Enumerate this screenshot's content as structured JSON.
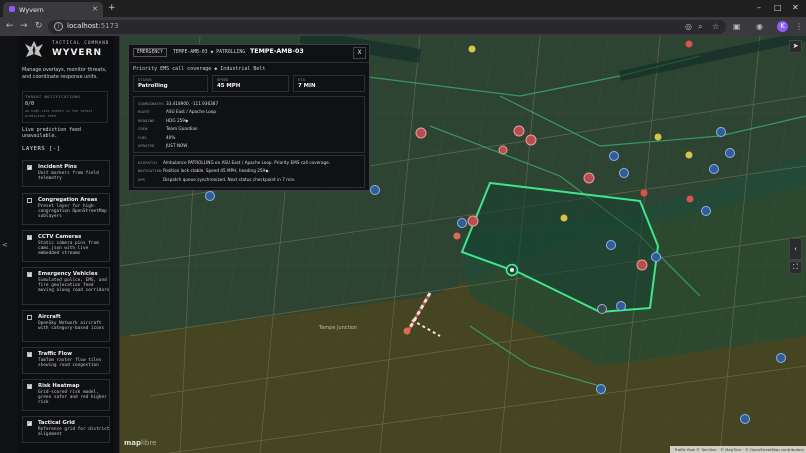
{
  "browser": {
    "tab_title": "Wyvern",
    "url_host": "localhost",
    "url_port": ":5173",
    "avatar_letter": "K"
  },
  "sidebar": {
    "brand_sub": "TACTICAL COMMAND",
    "brand_name": "WYVERN",
    "description": "Manage overlays, monitor threats, and coordinate response units.",
    "threat": {
      "title": "THREAT NOTIFICATIONS",
      "count": "0/0",
      "note": "no high-risk events in the latest prediction feed."
    },
    "feed_status": "Live prediction feed unavailable.",
    "layers_heading": "LAYERS [-]",
    "layers": [
      {
        "name": "Incident Pins",
        "desc": "Unit markers from field telemetry",
        "checked": true
      },
      {
        "name": "Congregation Areas",
        "desc": "Preset layer for high-congregation OpenStreetMap sublayers",
        "checked": false
      },
      {
        "name": "CCTV Cameras",
        "desc": "Static camera pins from cams.json with live embedded streams",
        "checked": true
      },
      {
        "name": "Emergency Vehicles",
        "desc": "Simulated police, EMS, and fire geolocation feed moving along road corridors",
        "checked": true
      },
      {
        "name": "Aircraft",
        "desc": "OpenSky Network aircraft with category-based icons",
        "checked": false
      },
      {
        "name": "Traffic Flow",
        "desc": "TomTom raster flow tiles showing road congestion",
        "checked": true
      },
      {
        "name": "Risk Heatmap",
        "desc": "Grid-scored risk model, green safer and red higher risk",
        "checked": true
      },
      {
        "name": "Tactical Grid",
        "desc": "Reference grid for district alignment",
        "checked": true
      }
    ]
  },
  "popup": {
    "tag": "EMERGENCY",
    "callsign_small": "TEMPE-AMB-03",
    "state_small": "PATROLLING",
    "callsign": "TEMPE-AMB-03",
    "close_label": "X",
    "subline": "Priority EMS call coverage ◆ Industrial Belt",
    "stats": [
      {
        "label": "STATUS",
        "value": "Patrolling"
      },
      {
        "label": "SPEED",
        "value": "45 MPH"
      },
      {
        "label": "ETA",
        "value": "7 MIN"
      }
    ],
    "details": [
      {
        "label": "COORDINATES",
        "value": "33.418900, -111.936387"
      },
      {
        "label": "ROUTE",
        "value": "ASU East / Apache Loop"
      },
      {
        "label": "HEADING",
        "value": "HDG 259◆"
      },
      {
        "label": "CREW",
        "value": "Team Guardian"
      },
      {
        "label": "FUEL",
        "value": "40%"
      },
      {
        "label": "UPDATED",
        "value": "JUST NOW"
      }
    ],
    "logs": [
      {
        "label": "DISPATCH",
        "value": "Ambulance PATROLLING on ASU East / Apache Loop. Priority EMS call coverage."
      },
      {
        "label": "NAVIGATION",
        "value": "Position lock stable. Speed 45 MPH, heading 259◆."
      },
      {
        "label": "OPS",
        "value": "Dispatch queue synchronized. Next status checkpoint in 7 min."
      }
    ]
  },
  "map": {
    "place_label": "Tempe Junction",
    "logo_text": "map",
    "logo_text2": "libre",
    "attribution": "Traffic flow © TomTom · © MapTiler · © OpenStreetMap contributors",
    "colors": {
      "risk_safe": "#1f6b4e",
      "risk_high": "#7a7a28",
      "route": "#37d67a",
      "incident": "#e05252",
      "cctv": "#3a7bd5",
      "alert": "#e0c040"
    }
  }
}
